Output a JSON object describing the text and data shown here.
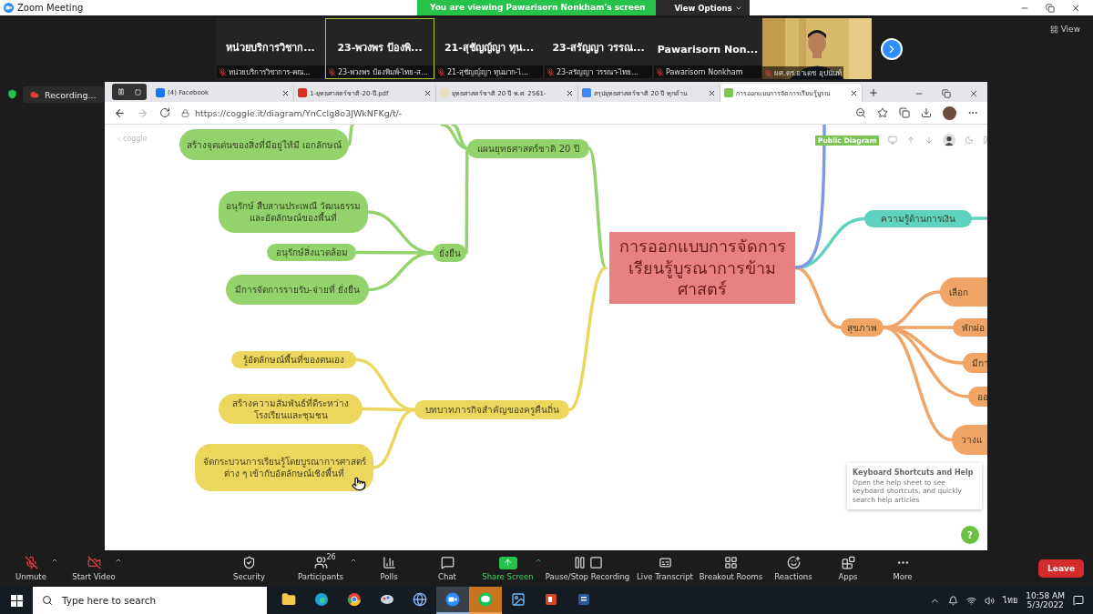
{
  "window": {
    "title": "Zoom Meeting",
    "banner": "You are viewing Pawarisorn Nonkham's screen",
    "view_options": "View Options"
  },
  "participants": [
    {
      "kind": "name",
      "name": "หน่วยบริการวิชาก...",
      "label": "หน่วยบริการวิชาการ-คณ...",
      "muted": true,
      "selected": false
    },
    {
      "kind": "name",
      "name": "23-พวงพร ป้องพิ...",
      "label": "23-พวงพร ป้องพิมพ์-ไทย-ส...",
      "muted": true,
      "selected": true
    },
    {
      "kind": "name",
      "name": "21-สุชัญญ์ญา ทุน...",
      "label": "21-สุชัญญ์ญา ทุนมาก-ไ...",
      "muted": true,
      "selected": false
    },
    {
      "kind": "name",
      "name": "23-สรัญญา วรรณ...",
      "label": "23-สรัญญา วรรณา-ไทย...",
      "muted": true,
      "selected": false
    },
    {
      "kind": "name",
      "name": "Pawarisorn Non...",
      "label": "Pawarisorn Nonkham",
      "muted": true,
      "selected": false
    },
    {
      "kind": "video",
      "label": "ผศ.ดร.อาเดช อุปนันท์",
      "muted": true,
      "selected": false
    }
  ],
  "view_button": "View",
  "recording": "Recording...",
  "browser": {
    "tabs": [
      {
        "kind": "facebook",
        "title": "(4) Facebook",
        "selected": false
      },
      {
        "kind": "pdf",
        "title": "1-ยุทธศาสตร์ชาติ-20-ปี.pdf",
        "selected": false
      },
      {
        "kind": "page",
        "title": "ยุทธศาสตร์ชาติ 20 ปี พ.ศ. 2561-",
        "selected": false
      },
      {
        "kind": "google",
        "title": "สรุปยุทธศาสตร์ชาติ 20 ปี ทุกด้าน",
        "selected": false
      },
      {
        "kind": "coggle",
        "title": "การออกแบบการจัดการเรียนรู้บูรณ",
        "selected": true
      }
    ],
    "url": "https://coggle.it/diagram/YnCclg8o3JWkNFKg/t/-"
  },
  "coggle": {
    "back": "coggle",
    "badge": "Public Diagram",
    "nodes": [
      {
        "text": "การออกแบบการจัดการเรียนรู้บูรณาการข้ามศาสตร์",
        "color": "#e88282"
      },
      {
        "text": "สร้างจุดเด่นของสิ่งที่มีอยู่ให้มี เอกลักษณ์",
        "color": "#92d36b"
      },
      {
        "text": "แผนยุทธศาสตร์ชาติ 20 ปี",
        "color": "#92d36b"
      },
      {
        "text": "ยั่งยืน",
        "color": "#92d36b"
      },
      {
        "text": "อนุรักษ์ สืบสานประเพณี วัฒนธรรม และอัตลักษณ์ของพื้นที่",
        "color": "#92d36b"
      },
      {
        "text": "อนุรักษ์สิ่งแวดล้อม",
        "color": "#92d36b"
      },
      {
        "text": "มีการจัดการรายรับ-จ่ายที่ ยั่งยืน",
        "color": "#92d36b"
      },
      {
        "text": "บทบาทภารกิจสำคัญของครูคืนถิ่น",
        "color": "#ebd65e"
      },
      {
        "text": "รู้อัตลักษณ์พื้นที่ของตนเอง",
        "color": "#ebd65e"
      },
      {
        "text": "สร้างความสัมพันธ์ที่ดีระหว่าง โรงเรียนและชุมชน",
        "color": "#ebd65e"
      },
      {
        "text": "จัดกระบวนการเรียนรู้โดยบูรณาการศาสตร์ต่าง ๆ เข้ากับอัตลักษณ์เชิงพื้นที่",
        "color": "#ebd65e"
      },
      {
        "text": "ความรู้ด้านการเงิน",
        "color": "#5fd3bd"
      },
      {
        "text": "สุขภาพ",
        "color": "#f0a566"
      },
      {
        "text": "เลือก",
        "color": "#f0a566"
      },
      {
        "text": "พักผ่อ",
        "color": "#f0a566"
      },
      {
        "text": "มีกา",
        "color": "#f0a566"
      },
      {
        "text": "ออ",
        "color": "#f0a566"
      },
      {
        "text": "วางแ",
        "color": "#f0a566"
      }
    ],
    "help": {
      "title": "Keyboard Shortcuts and Help",
      "text": "Open the help sheet to see keyboard shortcuts, and quickly search help articles",
      "button": "?"
    }
  },
  "toolbar": {
    "items": [
      {
        "kind": "mic",
        "label": "Unmute"
      },
      {
        "kind": "video",
        "label": "Start Video"
      },
      {
        "kind": "security",
        "label": "Security"
      },
      {
        "kind": "participants",
        "label": "Participants",
        "badge": "26"
      },
      {
        "kind": "polls",
        "label": "Polls"
      },
      {
        "kind": "chat",
        "label": "Chat"
      },
      {
        "kind": "share",
        "label": "Share Screen"
      },
      {
        "kind": "record",
        "label": "Pause/Stop Recording"
      },
      {
        "kind": "transcript",
        "label": "Live Transcript"
      },
      {
        "kind": "breakout",
        "label": "Breakout Rooms"
      },
      {
        "kind": "reactions",
        "label": "Reactions"
      },
      {
        "kind": "apps",
        "label": "Apps"
      },
      {
        "kind": "more",
        "label": "More"
      }
    ],
    "leave": "Leave"
  },
  "taskbar": {
    "search_placeholder": "Type here to search",
    "apps": [
      {
        "kind": "explorer",
        "selected": false,
        "attention": false
      },
      {
        "kind": "edge",
        "selected": false,
        "attention": false
      },
      {
        "kind": "chrome",
        "selected": false,
        "attention": false
      },
      {
        "kind": "paint",
        "selected": false,
        "attention": false
      },
      {
        "kind": "globe",
        "selected": false,
        "attention": false
      },
      {
        "kind": "zoom",
        "selected": true,
        "attention": false
      },
      {
        "kind": "line",
        "selected": false,
        "attention": true
      },
      {
        "kind": "photos",
        "selected": false,
        "attention": false
      },
      {
        "kind": "powerpoint",
        "selected": false,
        "attention": false
      },
      {
        "kind": "word",
        "selected": false,
        "attention": false
      }
    ],
    "language": "ไทย",
    "time": "10:58 AM",
    "date": "5/3/2022"
  }
}
